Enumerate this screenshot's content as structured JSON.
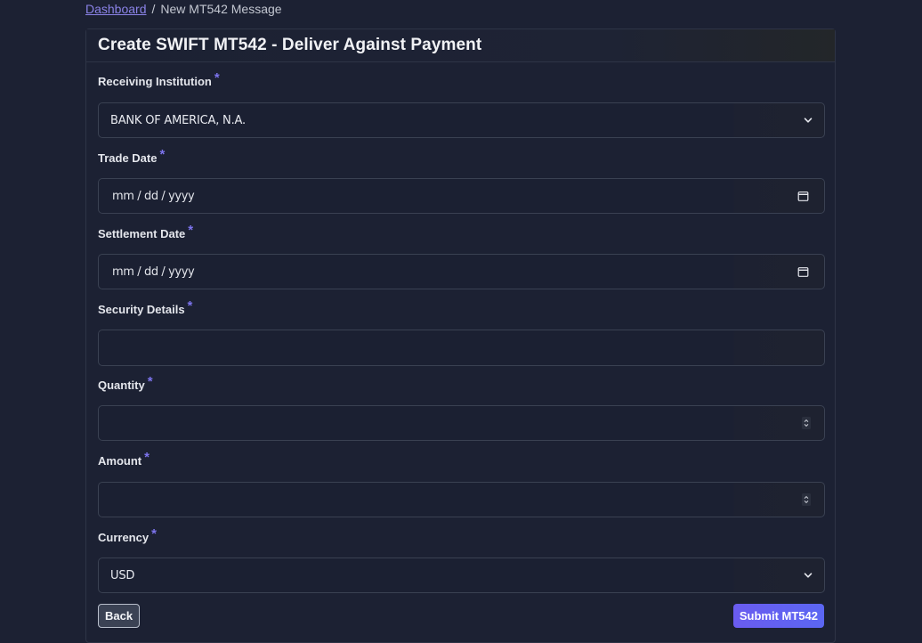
{
  "breadcrumb": {
    "home": "Dashboard",
    "separator": "/",
    "current": "New MT542 Message"
  },
  "card": {
    "title": "Create SWIFT MT542 - Deliver Against Payment"
  },
  "form": {
    "required_mark": "*",
    "receiving_institution": {
      "label": "Receiving Institution",
      "value": "BANK OF AMERICA, N.A.",
      "icon": "chevron-down-icon"
    },
    "trade_date": {
      "label": "Trade Date",
      "placeholder": "mm / dd / yyyy",
      "icon": "calendar-icon"
    },
    "settlement_date": {
      "label": "Settlement Date",
      "placeholder": "mm / dd / yyyy",
      "icon": "calendar-icon"
    },
    "security_details": {
      "label": "Security Details",
      "value": ""
    },
    "quantity": {
      "label": "Quantity",
      "value": "",
      "icon": "spinner-icon"
    },
    "amount": {
      "label": "Amount",
      "value": "",
      "icon": "spinner-icon"
    },
    "currency": {
      "label": "Currency",
      "value": "USD",
      "icon": "chevron-down-icon"
    }
  },
  "actions": {
    "back_label": "Back",
    "submit_label": "Submit MT542"
  },
  "colors": {
    "background": "#1c2133",
    "accent": "#6a5cf0",
    "link": "#8b83e8",
    "required": "#7d74ee"
  }
}
